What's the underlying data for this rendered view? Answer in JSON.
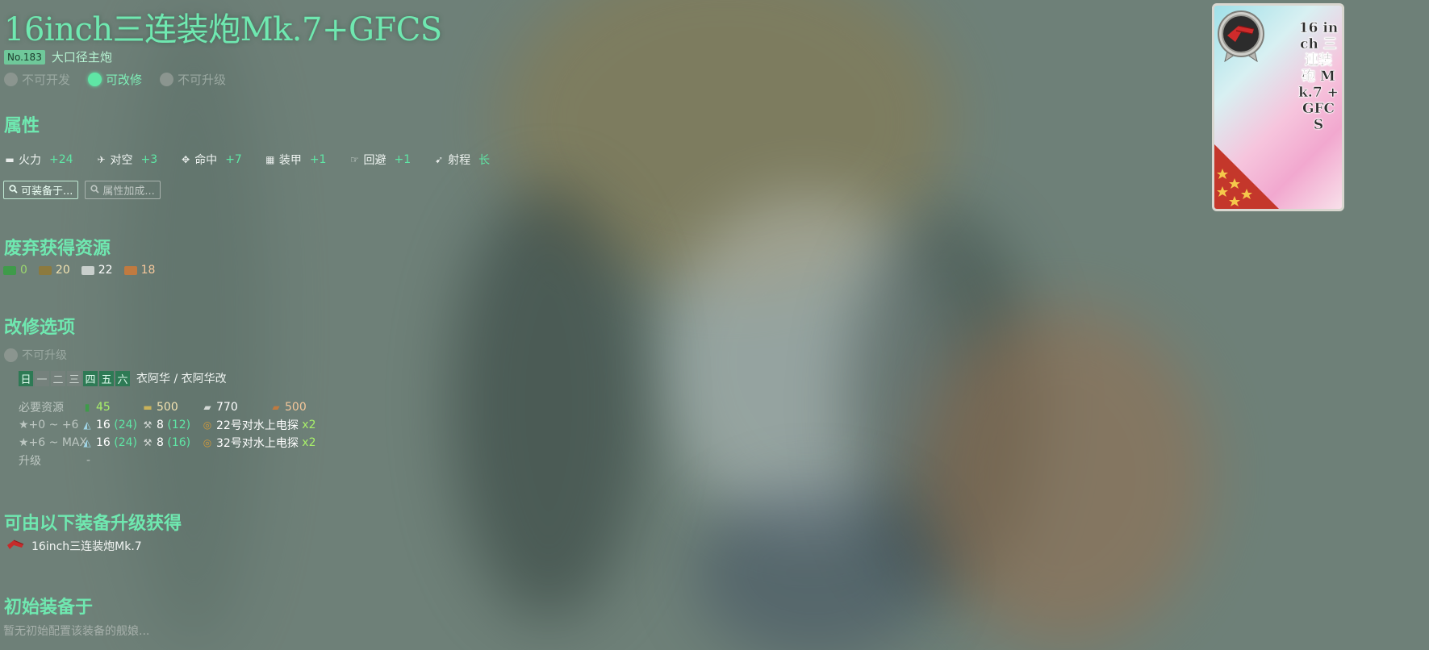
{
  "equipment": {
    "name": "16inch三连装炮Mk.7+GFCS",
    "number": "No.183",
    "type": "大口径主炮",
    "flags": [
      {
        "label": "不可开发",
        "active": false
      },
      {
        "label": "可改修",
        "active": true
      },
      {
        "label": "不可升级",
        "active": false
      }
    ]
  },
  "stats_section": {
    "heading": "属性",
    "items": [
      {
        "icon": "firepower-icon",
        "glyph": "▬",
        "label": "火力",
        "value": "+24"
      },
      {
        "icon": "anti-air-icon",
        "glyph": "✈",
        "label": "对空",
        "value": "+3"
      },
      {
        "icon": "accuracy-icon",
        "glyph": "✥",
        "label": "命中",
        "value": "+7"
      },
      {
        "icon": "armor-icon",
        "glyph": "▦",
        "label": "装甲",
        "value": "+1"
      },
      {
        "icon": "evasion-icon",
        "glyph": "☞",
        "label": "回避",
        "value": "+1"
      },
      {
        "icon": "range-icon",
        "glyph": "➹",
        "label": "射程",
        "value": "长"
      }
    ],
    "buttons": [
      {
        "label": "可装备于...",
        "icon": "search-icon"
      },
      {
        "label": "属性加成...",
        "icon": "search-icon"
      }
    ]
  },
  "scrap_section": {
    "heading": "废弃获得资源",
    "resources": [
      {
        "icon": "fuel-icon",
        "value": "0",
        "color": "#3f9b4a",
        "text_color": "#9bd86e"
      },
      {
        "icon": "ammo-icon",
        "value": "20",
        "color": "#8c7a3e",
        "text_color": "#f2e2b0"
      },
      {
        "icon": "steel-icon",
        "value": "22",
        "color": "#c9cfcc",
        "text_color": "#ffffff"
      },
      {
        "icon": "bauxite-icon",
        "value": "18",
        "color": "#c07a40",
        "text_color": "#f5c79b"
      }
    ]
  },
  "improvement_section": {
    "heading": "改修选项",
    "upgrade_flag": "不可升级",
    "days": [
      {
        "label": "日",
        "available": true
      },
      {
        "label": "一",
        "available": false
      },
      {
        "label": "二",
        "available": false
      },
      {
        "label": "三",
        "available": false
      },
      {
        "label": "四",
        "available": true
      },
      {
        "label": "五",
        "available": true
      },
      {
        "label": "六",
        "available": true
      }
    ],
    "ships": "衣阿华 / 衣阿华改",
    "required_label": "必要资源",
    "required": {
      "fuel": "45",
      "ammo": "500",
      "steel": "770",
      "bauxite": "500"
    },
    "rows": [
      {
        "label": "★+0 ~ +6",
        "devmat": "16",
        "devmat_sure": "(24)",
        "screw": "8",
        "screw_sure": "(12)",
        "equip": "22号对水上电探",
        "equip_count": "x2"
      },
      {
        "label": "★+6 ~ MAX",
        "devmat": "16",
        "devmat_sure": "(24)",
        "screw": "8",
        "screw_sure": "(16)",
        "equip": "32号对水上电探",
        "equip_count": "x2"
      }
    ],
    "upgrade_label": "升级",
    "upgrade_value": "-"
  },
  "upgrade_from_section": {
    "heading": "可由以下装备升级获得",
    "items": [
      {
        "name": "16inch三连装炮Mk.7"
      }
    ]
  },
  "initial_section": {
    "heading": "初始装备于",
    "empty_text": "暂无初始配置该装备的舰娘..."
  },
  "card": {
    "title": "16 inch 三連装砲 Mk.7 + GFCS",
    "rarity_stars": 5,
    "frame_color": "#c4372b"
  }
}
